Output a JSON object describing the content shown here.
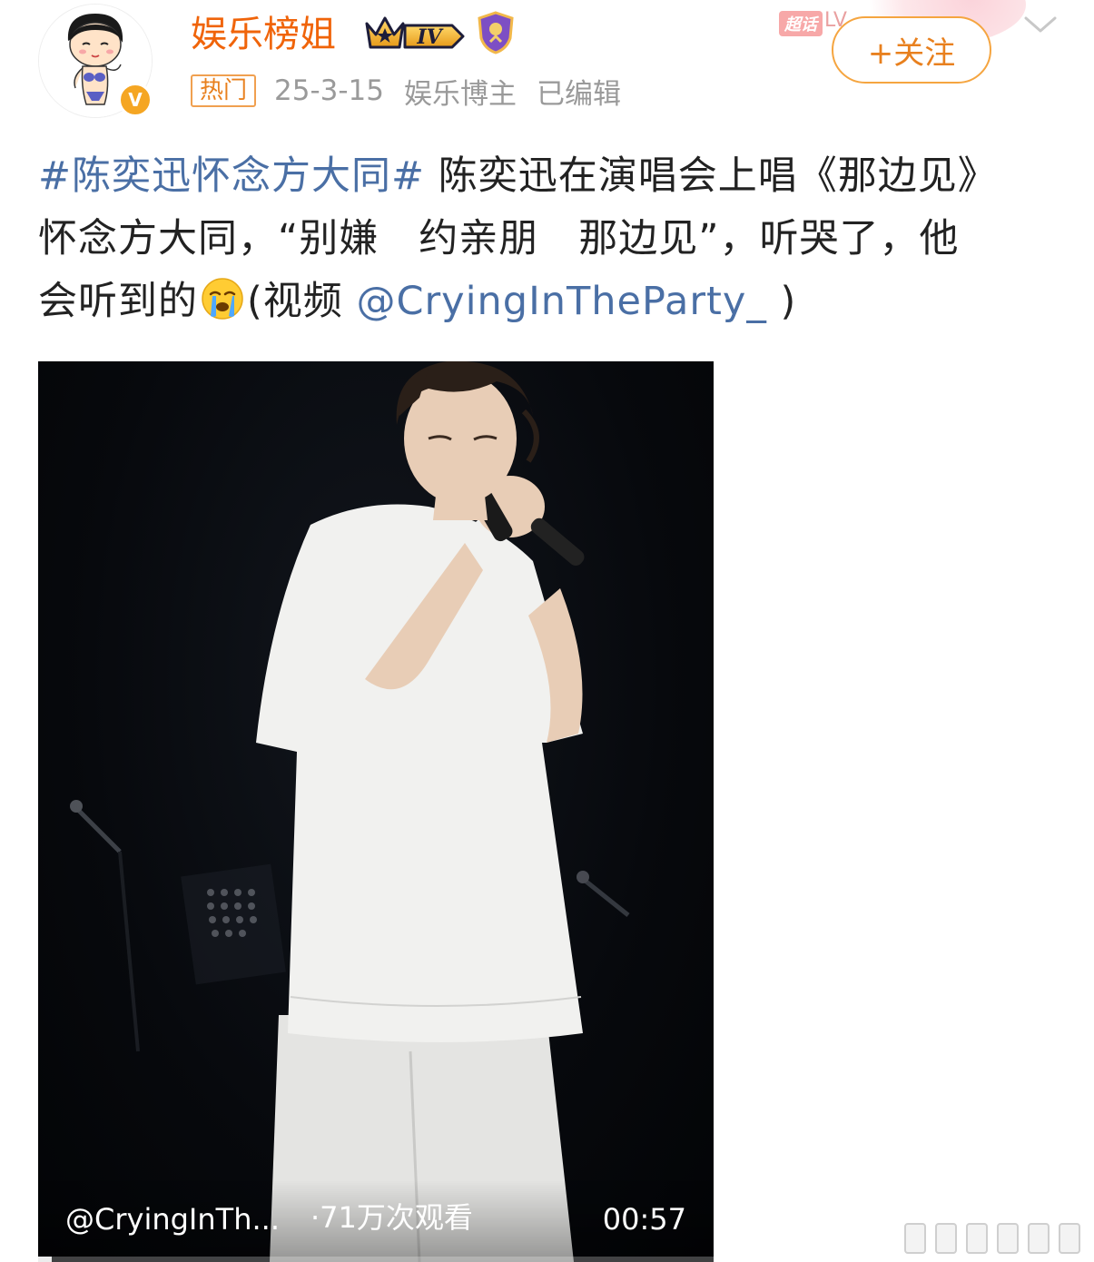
{
  "author": {
    "name": "娱乐榜姐",
    "verified_mark": "V",
    "level_badge": "IV",
    "hot_tag": "热门",
    "date": "25-3-15",
    "role": "娱乐博主",
    "edited": "已编辑"
  },
  "promo": {
    "chaohua": "超话",
    "lv": "LV"
  },
  "actions": {
    "follow_label": "+关注"
  },
  "post": {
    "hashtag": "#陈奕迅怀念方大同#",
    "line1_rest": " 陈奕迅在演唱会上唱《那边见》",
    "line2": "怀念方大同，“别嫌　约亲朋　那边见”，听哭了，他",
    "line3_prefix": "会听到的",
    "line3_video_prefix": "(视频 ",
    "mention": "@CryingInTheParty_",
    "line3_suffix": " )"
  },
  "video": {
    "author": "@CryingInTh...",
    "views": "·71万次观看",
    "duration": "00:57",
    "progress": 0.02
  },
  "icons": {
    "avatar": "cartoon-avatar-icon",
    "crown": "crown-badge-icon",
    "shield": "shield-badge-icon",
    "emoji": "crying-emoji-icon",
    "chevron": "chevron-down-icon"
  },
  "colors": {
    "username": "#f0640a",
    "link": "#4a6fa5",
    "follow": "#e8801e",
    "meta": "#9a9a9a"
  }
}
